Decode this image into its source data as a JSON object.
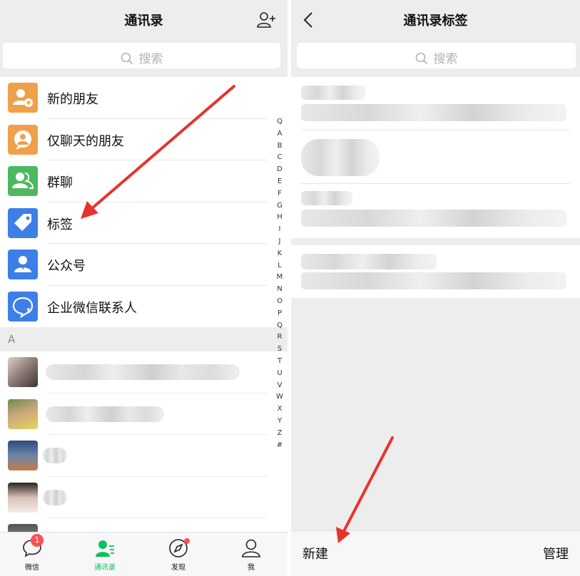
{
  "left_screen": {
    "title": "通讯录",
    "search_placeholder": "搜索",
    "menu": [
      {
        "label": "新的朋友",
        "icon": "new-friend-icon",
        "color": "#f0a04b"
      },
      {
        "label": "仅聊天的朋友",
        "icon": "chat-only-friends-icon",
        "color": "#f0a04b"
      },
      {
        "label": "群聊",
        "icon": "group-chat-icon",
        "color": "#4cb960"
      },
      {
        "label": "标签",
        "icon": "tag-icon",
        "color": "#3e7ee7"
      },
      {
        "label": "公众号",
        "icon": "official-account-icon",
        "color": "#3e7ee7"
      },
      {
        "label": "企业微信联系人",
        "icon": "work-contacts-icon",
        "color": "#3e7ee7"
      }
    ],
    "section_letter": "A",
    "index_letters": [
      "Q",
      "A",
      "B",
      "C",
      "D",
      "E",
      "F",
      "G",
      "H",
      "I",
      "J",
      "K",
      "L",
      "M",
      "N",
      "O",
      "P",
      "Q",
      "R",
      "S",
      "T",
      "U",
      "V",
      "W",
      "X",
      "Y",
      "Z",
      "#"
    ],
    "tabs": [
      {
        "label": "微信",
        "icon": "chat-bubble-icon",
        "badge": "1",
        "active": false
      },
      {
        "label": "通讯录",
        "icon": "contacts-icon",
        "active": true
      },
      {
        "label": "发现",
        "icon": "compass-icon",
        "dot": true,
        "active": false
      },
      {
        "label": "我",
        "icon": "profile-icon",
        "active": false
      }
    ]
  },
  "right_screen": {
    "title": "通讯录标签",
    "search_placeholder": "搜索",
    "new_label": "新建",
    "manage_label": "管理"
  },
  "colors": {
    "accent_green": "#07c160",
    "badge_red": "#fa5151",
    "annotation_arrow": "#e8332d"
  }
}
